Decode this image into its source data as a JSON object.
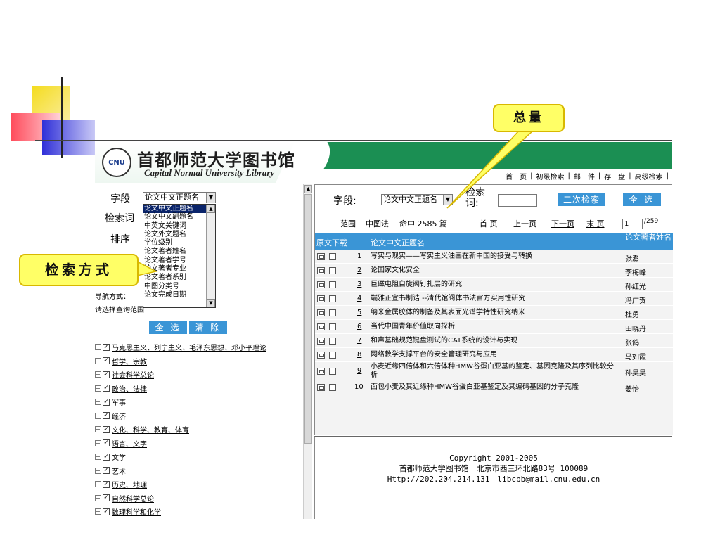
{
  "header": {
    "seal_text": "CNU",
    "logo_cn": "首都师范大学图书馆",
    "logo_en": "Capital Normal University Library",
    "nav": [
      "首　页",
      "初级检索",
      "邮　件",
      "存　盘",
      "高级检索"
    ]
  },
  "left": {
    "field_label": "字段",
    "field_value": "论文中文正题名",
    "keyword_label": "检索词",
    "sort_label": "排序",
    "field_options": [
      "论文中文正题名",
      "论文中文副题名",
      "中英文关键词",
      "论文外文题名",
      "学位级别",
      "论文著者姓名",
      "论文著者学号",
      "论文著者专业",
      "论文著者系别",
      "中图分类号",
      "论文完成日期"
    ],
    "nav_mode_label": "导航方式：",
    "range_label": "请选择查询范围",
    "select_all": "全 选",
    "clear": "清 除",
    "tree": [
      "马克思主义、列宁主义、毛泽东思想、邓小平理论",
      "哲学、宗教",
      "社会科学总论",
      "政治、法律",
      "军事",
      "经济",
      "文化、科学、教育、体育",
      "语言、文字",
      "文学",
      "艺术",
      "历史、地理",
      "自然科学总论",
      "数理科学和化学"
    ]
  },
  "right": {
    "field_label": "字段:",
    "field_value": "论文中文正题名",
    "keyword_label": "检索词:",
    "second_search": "二次检索",
    "select_all": "全 选",
    "range_text": "范围",
    "category": "中图法",
    "hits_text": "命中 2585 篇",
    "first_page": "首 页",
    "prev_page": "上一页",
    "next_page": "下一页",
    "last_page": "末 页",
    "page_value": "1",
    "page_total": "/259",
    "col_download": "原文下载",
    "col_title": "论文中文正题名",
    "col_author": "论文著者姓名",
    "rows": [
      {
        "num": "1",
        "title": "写实与现实——写实主义油画在新中国的接受与转换",
        "author": "张澎"
      },
      {
        "num": "2",
        "title": "论国家文化安全",
        "author": "李梅峰"
      },
      {
        "num": "3",
        "title": "巨磁电阻自旋阀钉扎层的研究",
        "author": "孙红光"
      },
      {
        "num": "4",
        "title": "端雅正宜书制诰 --清代馆阁体书法官方实用性研究",
        "author": "冯广贺"
      },
      {
        "num": "5",
        "title": "纳米金属胶体的制备及其表面光谱学特性研究纳米",
        "author": "杜勇"
      },
      {
        "num": "6",
        "title": "当代中国青年价值取向探析",
        "author": "田晓丹"
      },
      {
        "num": "7",
        "title": "和声基础规范键盘测试的CAT系统的设计与实现",
        "author": "张鸽"
      },
      {
        "num": "8",
        "title": "网络教学支撑平台的安全管理研究与应用",
        "author": "马如霞"
      },
      {
        "num": "9",
        "title": "小麦近缘四倍体和六倍体种HMW谷蛋白亚基的鉴定、基因克隆及其序列比较分析",
        "author": "孙昊昊"
      },
      {
        "num": "10",
        "title": "面包小麦及其近缘种HMW谷蛋白亚基鉴定及其编码基因的分子克隆",
        "author": "姜怡"
      }
    ]
  },
  "footer": {
    "line1": "Copyright 2001-2005",
    "line2": "首都师范大学图书馆　北京市西三环北路83号 100089",
    "line3": "Http://202.204.214.131　libcbb@mail.cnu.edu.cn"
  },
  "callouts": {
    "total": "总量",
    "method": "检索方式"
  },
  "colors": {
    "header_green": "#1b8f53",
    "button_blue": "#3a95d6",
    "callout_yellow": "#ffff66"
  }
}
